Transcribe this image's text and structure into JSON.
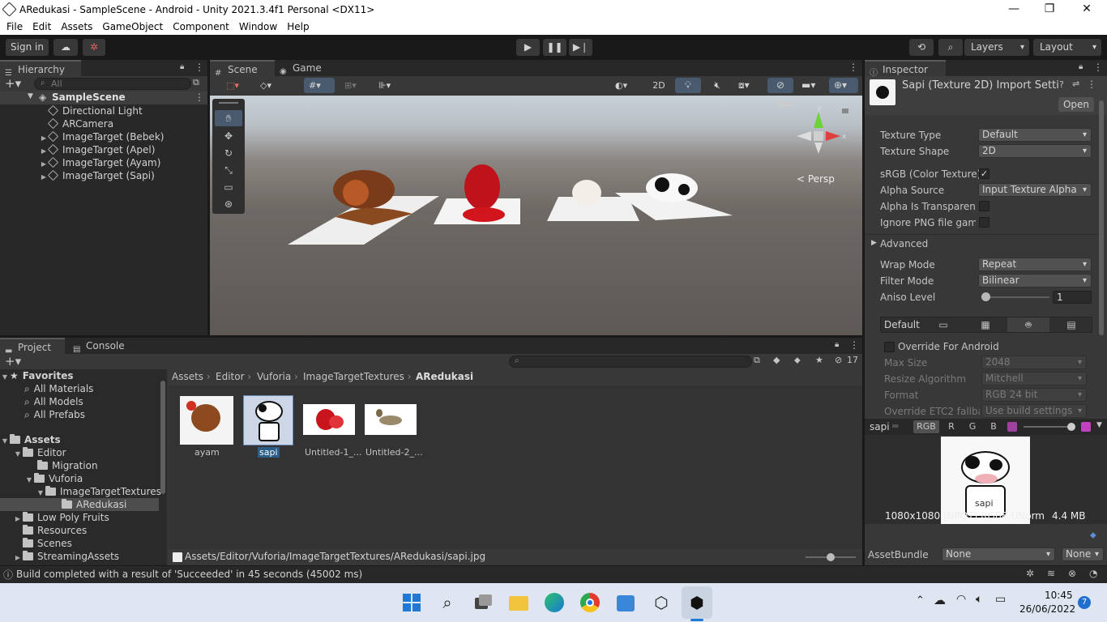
{
  "window": {
    "title": "ARedukasi - SampleScene - Android - Unity 2021.3.4f1 Personal <DX11>",
    "min": "—",
    "max": "❐",
    "close": "✕"
  },
  "menu": [
    "File",
    "Edit",
    "Assets",
    "GameObject",
    "Component",
    "Window",
    "Help"
  ],
  "toolbar": {
    "signin": "Sign in",
    "layers": "Layers",
    "layout": "Layout"
  },
  "hierarchy": {
    "tab": "Hierarchy",
    "search_placeholder": "All",
    "scene": "SampleScene",
    "items": [
      "Directional Light",
      "ARCamera",
      "ImageTarget (Bebek)",
      "ImageTarget (Apel)",
      "ImageTarget (Ayam)",
      "ImageTarget (Sapi)"
    ]
  },
  "scene_view": {
    "tab_scene": "Scene",
    "tab_game": "Game",
    "mode_2d": "2D",
    "persp": "< Persp",
    "gizmo_axes": {
      "x": "x",
      "y": "y"
    }
  },
  "inspector": {
    "tab": "Inspector",
    "title": "Sapi (Texture 2D) Import Setti",
    "open": "Open",
    "fields": [
      {
        "label": "Texture Type",
        "value": "Default"
      },
      {
        "label": "Texture Shape",
        "value": "2D"
      }
    ],
    "srgb_label": "sRGB (Color Texture)",
    "srgb_checked": "✓",
    "alpha_source_label": "Alpha Source",
    "alpha_source_value": "Input Texture Alpha",
    "alpha_transparency_label": "Alpha Is Transparenc",
    "ignore_png_label": "Ignore PNG file gamm",
    "advanced": "Advanced",
    "wrap_label": "Wrap Mode",
    "wrap_value": "Repeat",
    "filter_label": "Filter Mode",
    "filter_value": "Bilinear",
    "aniso_label": "Aniso Level",
    "aniso_value": "1",
    "platform_default": "Default",
    "override_label": "Override For Android",
    "platform_fields": [
      {
        "label": "Max Size",
        "value": "2048"
      },
      {
        "label": "Resize Algorithm",
        "value": "Mitchell"
      },
      {
        "label": "Format",
        "value": "RGB 24 bit"
      },
      {
        "label": "Override ETC2 fallbac",
        "value": "Use build settings"
      }
    ],
    "preview_name": "sapi",
    "channels": [
      "RGB",
      "R",
      "G",
      "B"
    ],
    "preview_overlay_name": "sapi",
    "preview_info": "1080x1080 (NPOT)  RGB8 UNorm",
    "preview_size": "4.4 MB",
    "assetbundle_label": "AssetBundle",
    "assetbundle_value": "None",
    "assetbundle_variant": "None"
  },
  "project": {
    "tab_project": "Project",
    "tab_console": "Console",
    "hidden_count": "17",
    "favorites": "Favorites",
    "fav_items": [
      "All Materials",
      "All Models",
      "All Prefabs"
    ],
    "assets": "Assets",
    "tree": [
      {
        "label": "Editor",
        "indent": 1,
        "open": true
      },
      {
        "label": "Migration",
        "indent": 2,
        "open": null
      },
      {
        "label": "Vuforia",
        "indent": 2,
        "open": true
      },
      {
        "label": "ImageTargetTextures",
        "indent": 3,
        "open": true
      },
      {
        "label": "ARedukasi",
        "indent": 4,
        "open": null
      },
      {
        "label": "Low Poly Fruits",
        "indent": 1,
        "open": false
      },
      {
        "label": "Resources",
        "indent": 1,
        "open": null
      },
      {
        "label": "Scenes",
        "indent": 1,
        "open": null
      },
      {
        "label": "StreamingAssets",
        "indent": 1,
        "open": false
      }
    ],
    "breadcrumb": [
      "Assets",
      "Editor",
      "Vuforia",
      "ImageTargetTextures",
      "ARedukasi"
    ],
    "files": [
      "ayam",
      "sapi",
      "Untitled-1_...",
      "Untitled-2_..."
    ],
    "selected_path": "Assets/Editor/Vuforia/ImageTargetTextures/ARedukasi/sapi.jpg"
  },
  "status": {
    "message": "Build completed with a result of 'Succeeded' in 45 seconds (45002 ms)"
  },
  "taskbar": {
    "time": "10:45",
    "date": "26/06/2022",
    "notifications": "7"
  }
}
